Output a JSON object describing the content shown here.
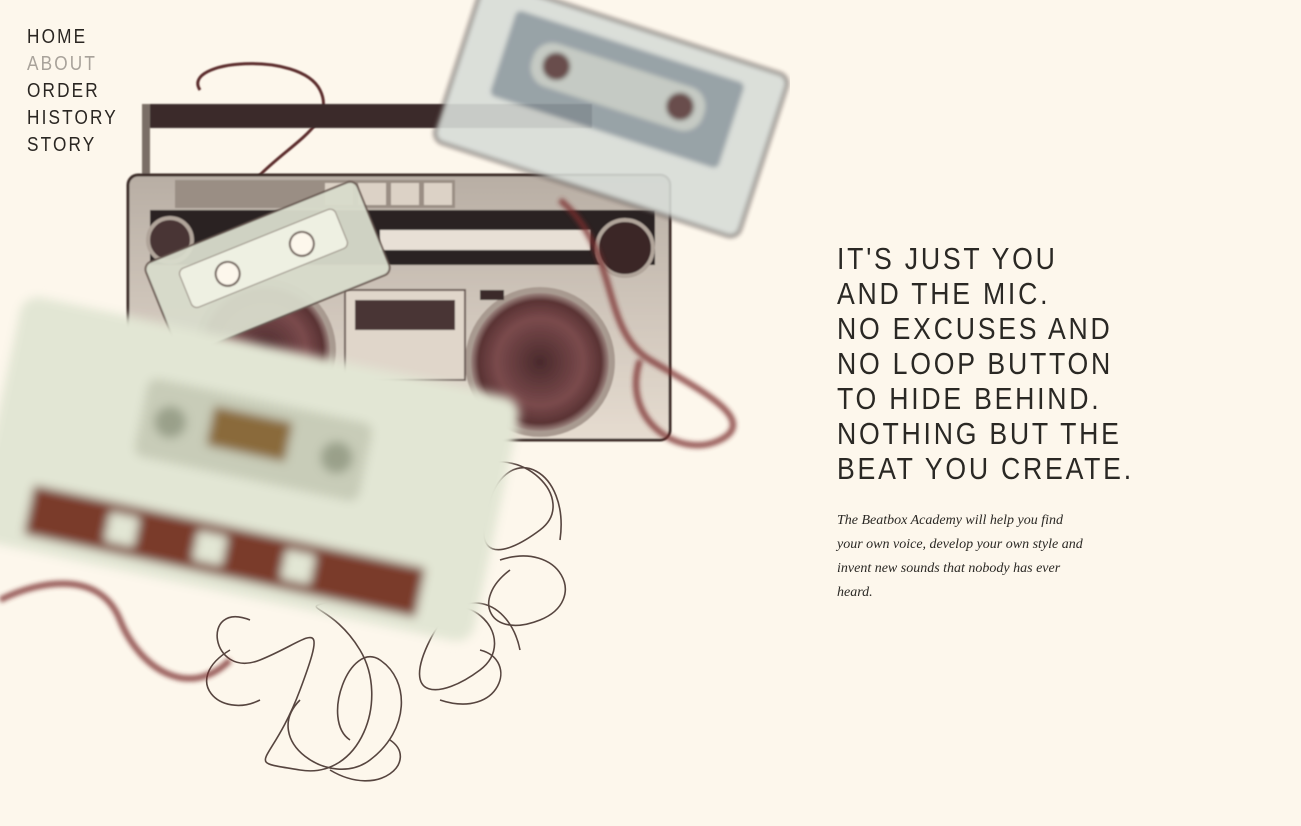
{
  "nav": {
    "items": [
      {
        "label": "HOME",
        "active": false
      },
      {
        "label": "ABOUT",
        "active": true
      },
      {
        "label": "ORDER",
        "active": false
      },
      {
        "label": "HISTORY",
        "active": false
      },
      {
        "label": "STORY",
        "active": false
      }
    ]
  },
  "hero": {
    "headline_lines": [
      "IT'S JUST YOU",
      "AND THE MIC.",
      "NO EXCUSES AND",
      "NO LOOP BUTTON",
      "TO HIDE BEHIND.",
      "NOTHING BUT THE",
      "BEAT YOU CREATE."
    ],
    "blurb": "The Beatbox Academy will help you find your own voice, develop your own style and invent new sounds that nobody has ever heard.",
    "image_icon": "boombox-and-cassettes-illustration"
  },
  "colors": {
    "background": "#fdf7ec",
    "text": "#2a2824",
    "nav_active": "#a8a29a",
    "tape": "#6a2a2a",
    "cassette_light": "#dfe2cf"
  }
}
